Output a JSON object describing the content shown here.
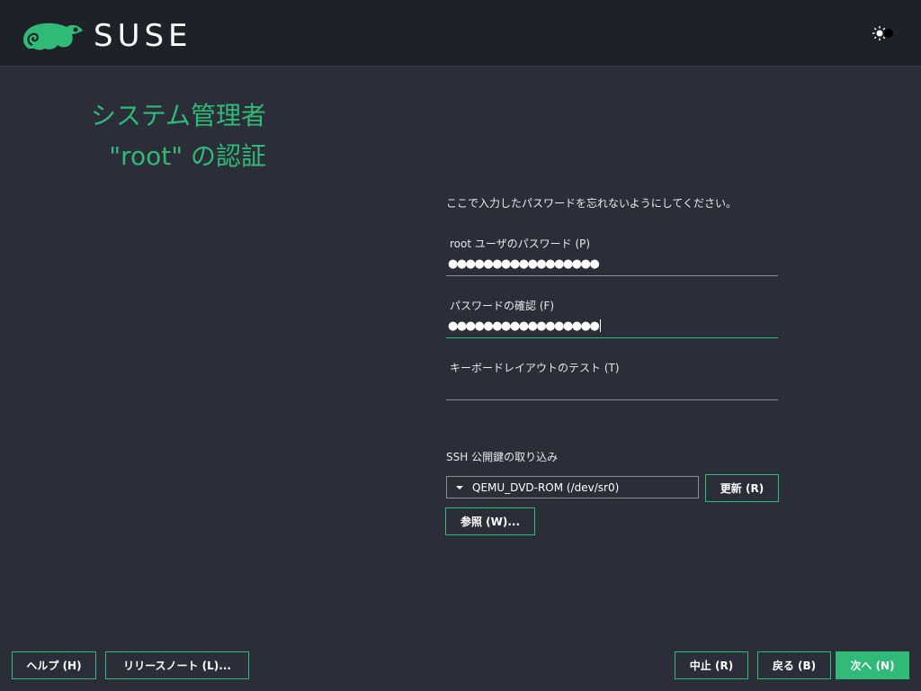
{
  "header": {
    "brand": "SUSE",
    "theme_toggle_icon": "sun-moon-icon",
    "accent": "#30ba78"
  },
  "title": {
    "line1": "システム管理者",
    "line2": "\"root\" の認証"
  },
  "form": {
    "hint": "ここで入力したパスワードを忘れないようにしてください。",
    "password_label": "root ユーザのパスワード (P)",
    "password_value": "●●●●●●●●●●●●●●●●●",
    "confirm_label": "パスワードの確認 (F)",
    "confirm_value": "●●●●●●●●●●●●●●●●●",
    "keyboard_test_label": "キーボードレイアウトのテスト (T)",
    "keyboard_test_value": ""
  },
  "ssh": {
    "section_label": "SSH 公開鍵の取り込み",
    "selected_device": "QEMU_DVD-ROM (/dev/sr0)",
    "refresh_button": "更新 (R)",
    "browse_button": "参照 (W)..."
  },
  "footer": {
    "help": "ヘルプ (H)",
    "release_notes": "リリースノート (L)...",
    "abort": "中止 (R)",
    "back": "戻る (B)",
    "next": "次へ (N)"
  }
}
